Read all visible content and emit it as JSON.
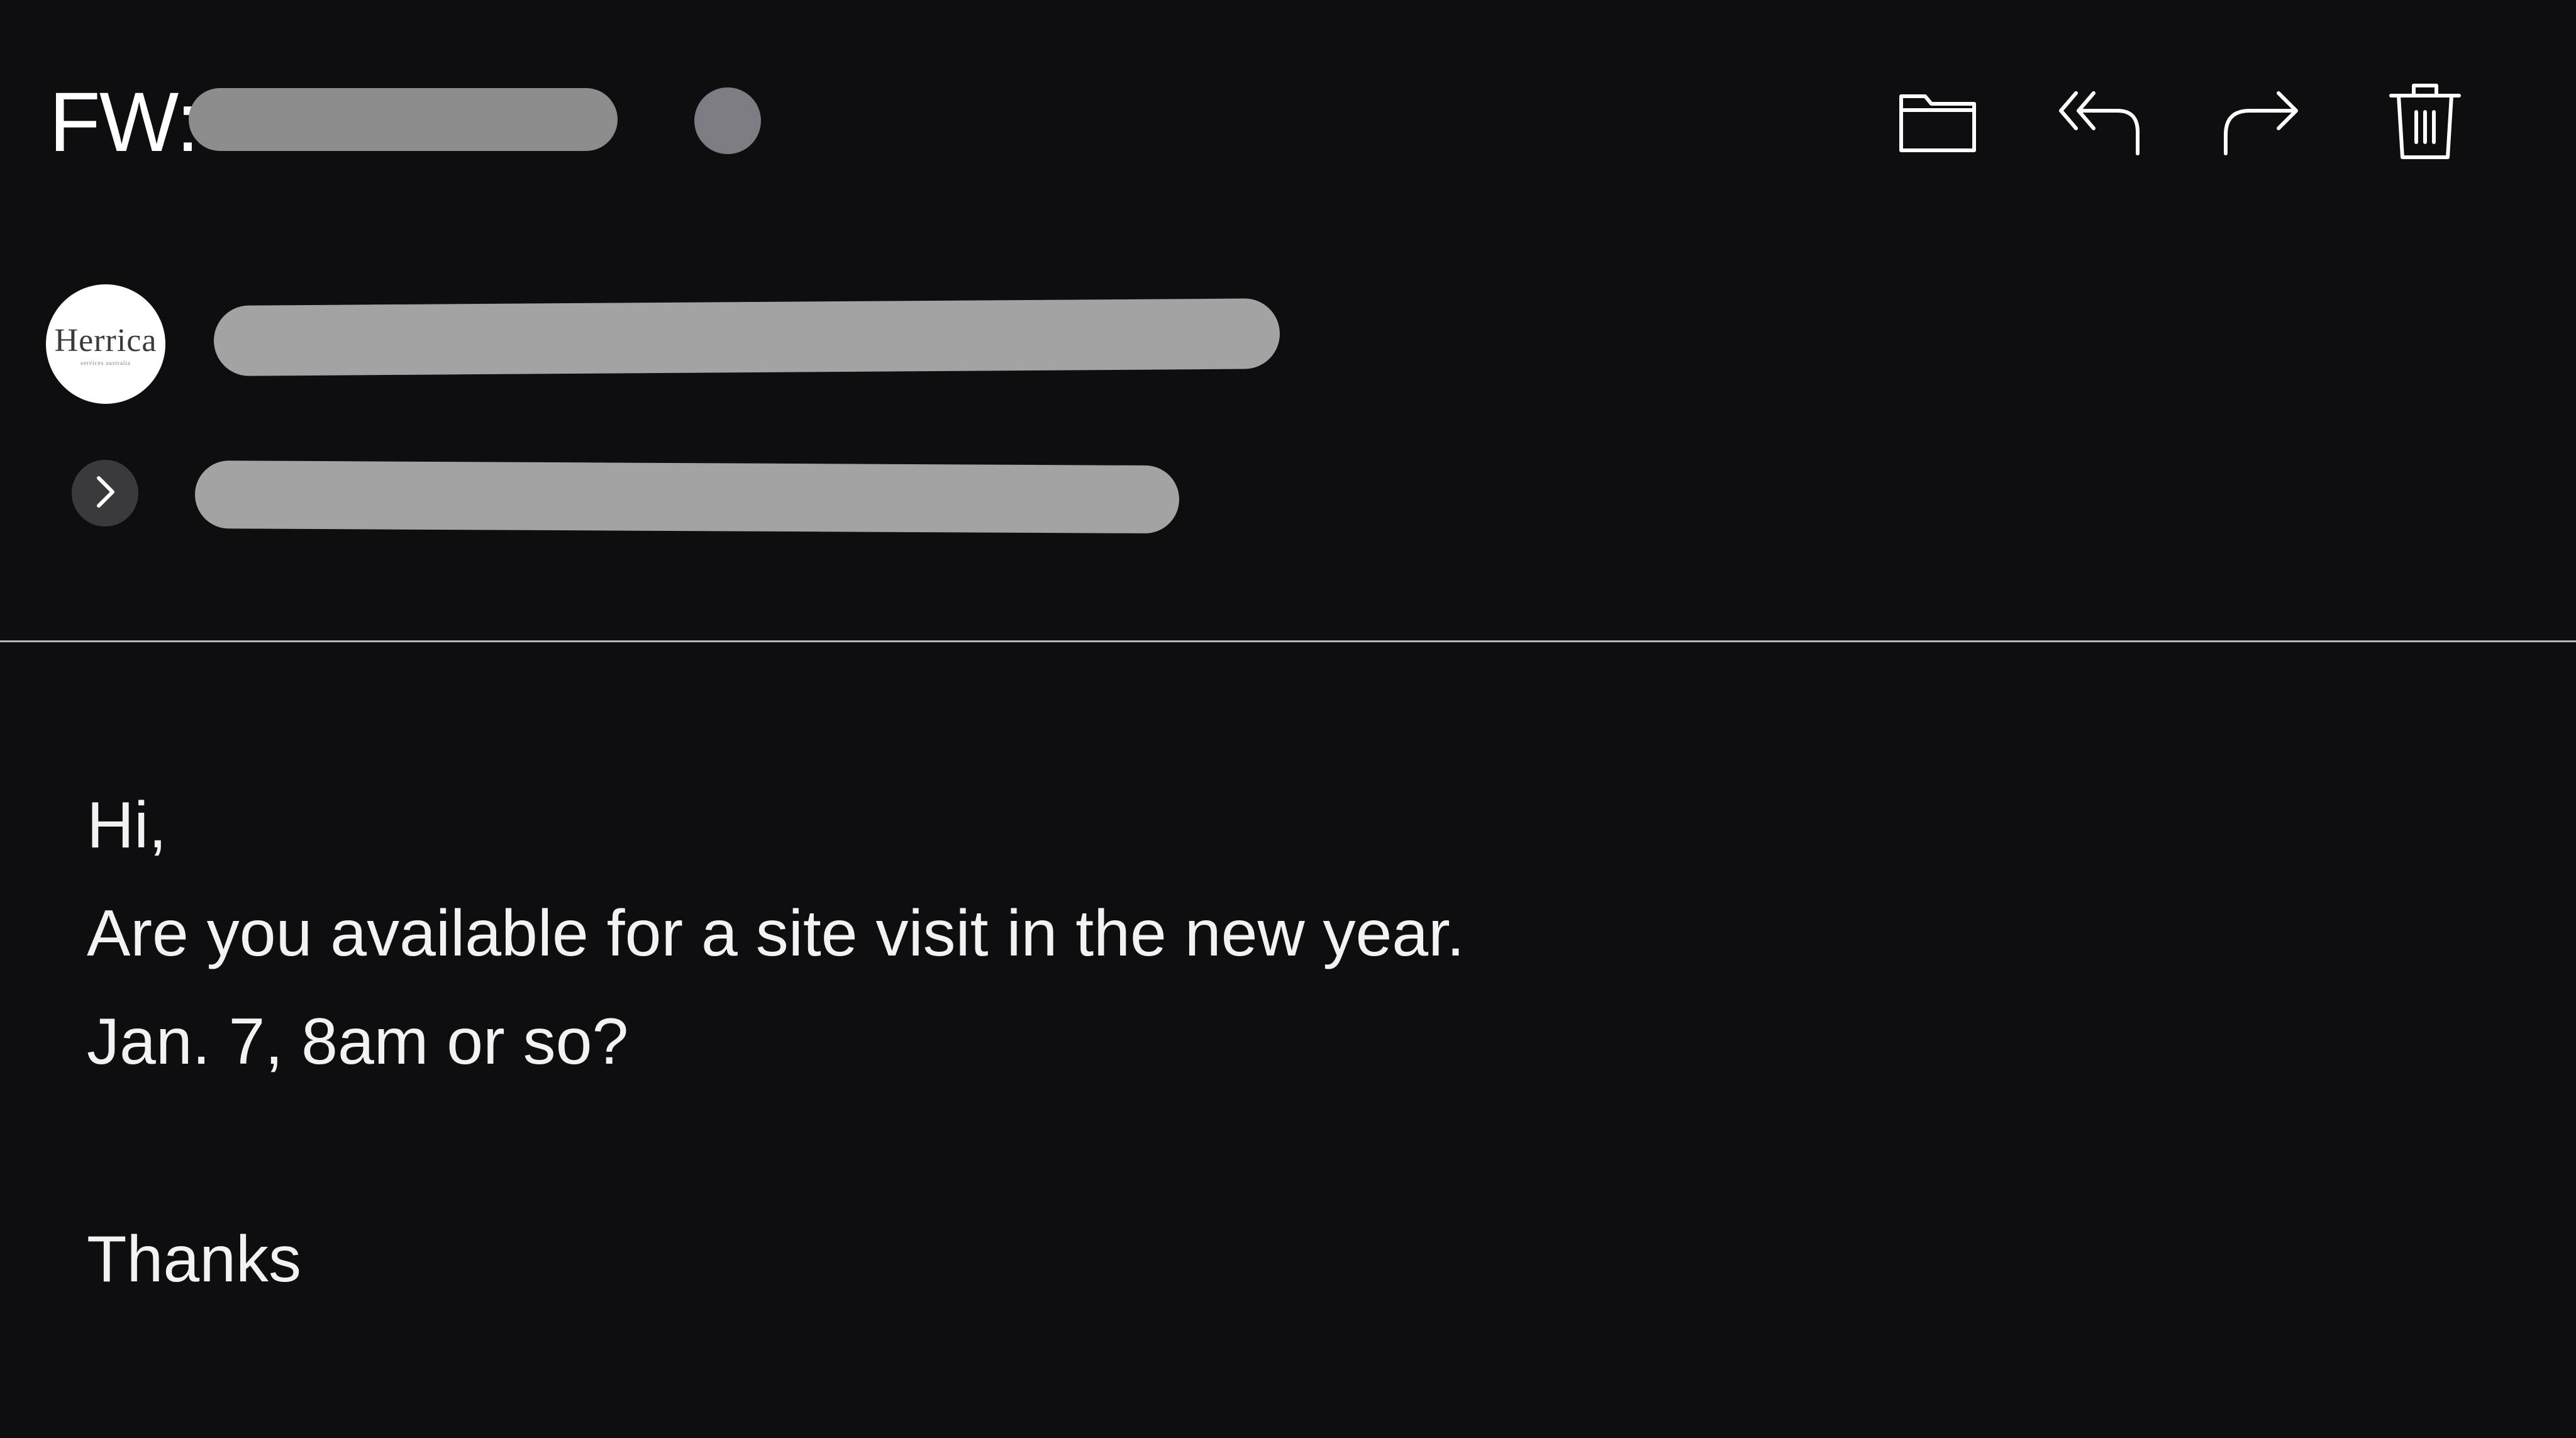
{
  "email": {
    "subject_prefix": "FW:",
    "subject_redacted": true,
    "sender_redacted": true,
    "recipients_redacted": true,
    "avatar": {
      "logo_text": "Herrica",
      "logo_subtext": "services australia"
    }
  },
  "toolbar": {
    "items": [
      {
        "name": "move-to-folder",
        "icon": "folder-icon"
      },
      {
        "name": "reply-all",
        "icon": "reply-all-icon"
      },
      {
        "name": "forward",
        "icon": "forward-icon"
      },
      {
        "name": "delete",
        "icon": "trash-icon"
      }
    ]
  },
  "body": {
    "lines": [
      "Hi,",
      "Are you available for a site visit in the new year.",
      "Jan. 7, 8am or so?",
      "Thanks"
    ]
  },
  "colors": {
    "background": "#0e0d0f",
    "text": "#ffffff",
    "redaction": "#a3a3a3",
    "unread_dot": "#7d7c82",
    "divider": "#b8b8b8"
  }
}
